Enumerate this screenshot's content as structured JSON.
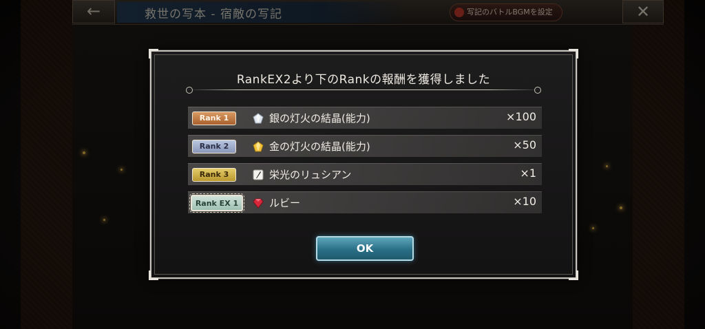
{
  "header": {
    "back_icon": "back-arrow-icon",
    "title": "救世の写本 - 宿敵の写記",
    "bgm_button_label": "写記のバトルBGMを設定",
    "close_icon": "close-icon"
  },
  "dialog": {
    "title": "RankEX2より下のRankの報酬を獲得しました",
    "rewards": [
      {
        "rank": "Rank 1",
        "icon": "silver-crystal-icon",
        "item": "銀の灯火の結晶(能力)",
        "quantity": "×100"
      },
      {
        "rank": "Rank 2",
        "icon": "gold-crystal-icon",
        "item": "金の灯火の結晶(能力)",
        "quantity": "×50"
      },
      {
        "rank": "Rank 3",
        "icon": "feather-quill-icon",
        "item": "栄光のリュシアン",
        "quantity": "×1"
      },
      {
        "rank": "Rank EX 1",
        "icon": "ruby-icon",
        "item": "ルビー",
        "quantity": "×10"
      }
    ],
    "ok_label": "OK"
  },
  "colors": {
    "ok_button": "#2a6f86",
    "rank1": "#a9612e",
    "rank2": "#8a96b8",
    "rank3": "#b8962e",
    "rank_ex": "#9fc0b4"
  }
}
